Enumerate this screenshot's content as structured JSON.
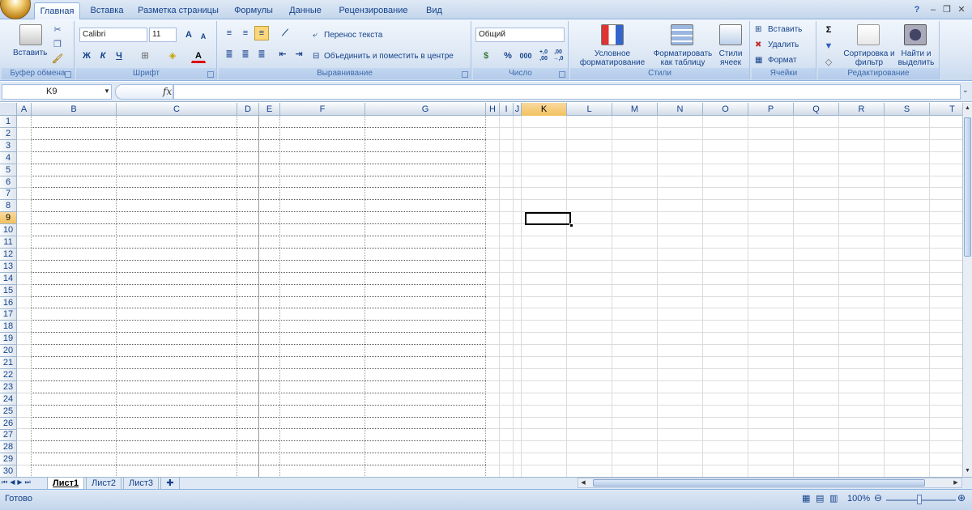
{
  "tabs": [
    "Главная",
    "Вставка",
    "Разметка страницы",
    "Формулы",
    "Данные",
    "Рецензирование",
    "Вид"
  ],
  "active_tab": "Главная",
  "window_controls": {
    "help": "?",
    "minimize": "–",
    "restore": "❐",
    "close": "✕"
  },
  "ribbon": {
    "clipboard": {
      "label": "Буфер обмена",
      "paste": "Вставить"
    },
    "font": {
      "label": "Шрифт",
      "font_name": "Calibri",
      "font_size": "11",
      "bold": "Ж",
      "italic": "К",
      "underline": "Ч",
      "grow": "A",
      "shrink": "A",
      "font_color": "A"
    },
    "alignment": {
      "label": "Выравнивание",
      "wrap_text": "Перенос текста",
      "merge_center": "Объединить и поместить в центре"
    },
    "number": {
      "label": "Число",
      "format": "Общий",
      "percent": "%",
      "thousands": "000",
      "inc_decimal": "+,0 ,00",
      "dec_decimal": ",00 →,0"
    },
    "styles": {
      "label": "Стили",
      "conditional": "Условное форматирование",
      "format_table": "Форматировать как таблицу",
      "cell_styles": "Стили ячеек"
    },
    "cells": {
      "label": "Ячейки",
      "insert": "Вставить",
      "delete": "Удалить",
      "format": "Формат"
    },
    "editing": {
      "label": "Редактирование",
      "sigma": "Σ",
      "sort": "Сортировка и фильтр",
      "find": "Найти и выделить"
    }
  },
  "formula_bar": {
    "name_box": "K9",
    "fx": "fx",
    "value": ""
  },
  "grid": {
    "columns": [
      "A",
      "B",
      "C",
      "D",
      "E",
      "F",
      "G",
      "H",
      "I",
      "J",
      "K",
      "L",
      "M",
      "N",
      "O",
      "P",
      "Q",
      "R",
      "S",
      "T"
    ],
    "selected_column": "K",
    "rows": [
      "1",
      "2",
      "3",
      "4",
      "5",
      "6",
      "7",
      "8",
      "9",
      "10",
      "11",
      "12",
      "13",
      "14",
      "15",
      "16",
      "17",
      "18",
      "19",
      "20",
      "21",
      "22",
      "23",
      "24",
      "25",
      "26",
      "27",
      "28",
      "29",
      "30"
    ],
    "selected_row": "9",
    "selected_cell": "K9"
  },
  "sheets": [
    "Лист1",
    "Лист2",
    "Лист3"
  ],
  "active_sheet": "Лист1",
  "status": {
    "ready": "Готово",
    "zoom": "100%"
  },
  "colors": {
    "accent": "#15428b",
    "selection": "#f1c15f",
    "ribbon": "#dfe9f5"
  }
}
